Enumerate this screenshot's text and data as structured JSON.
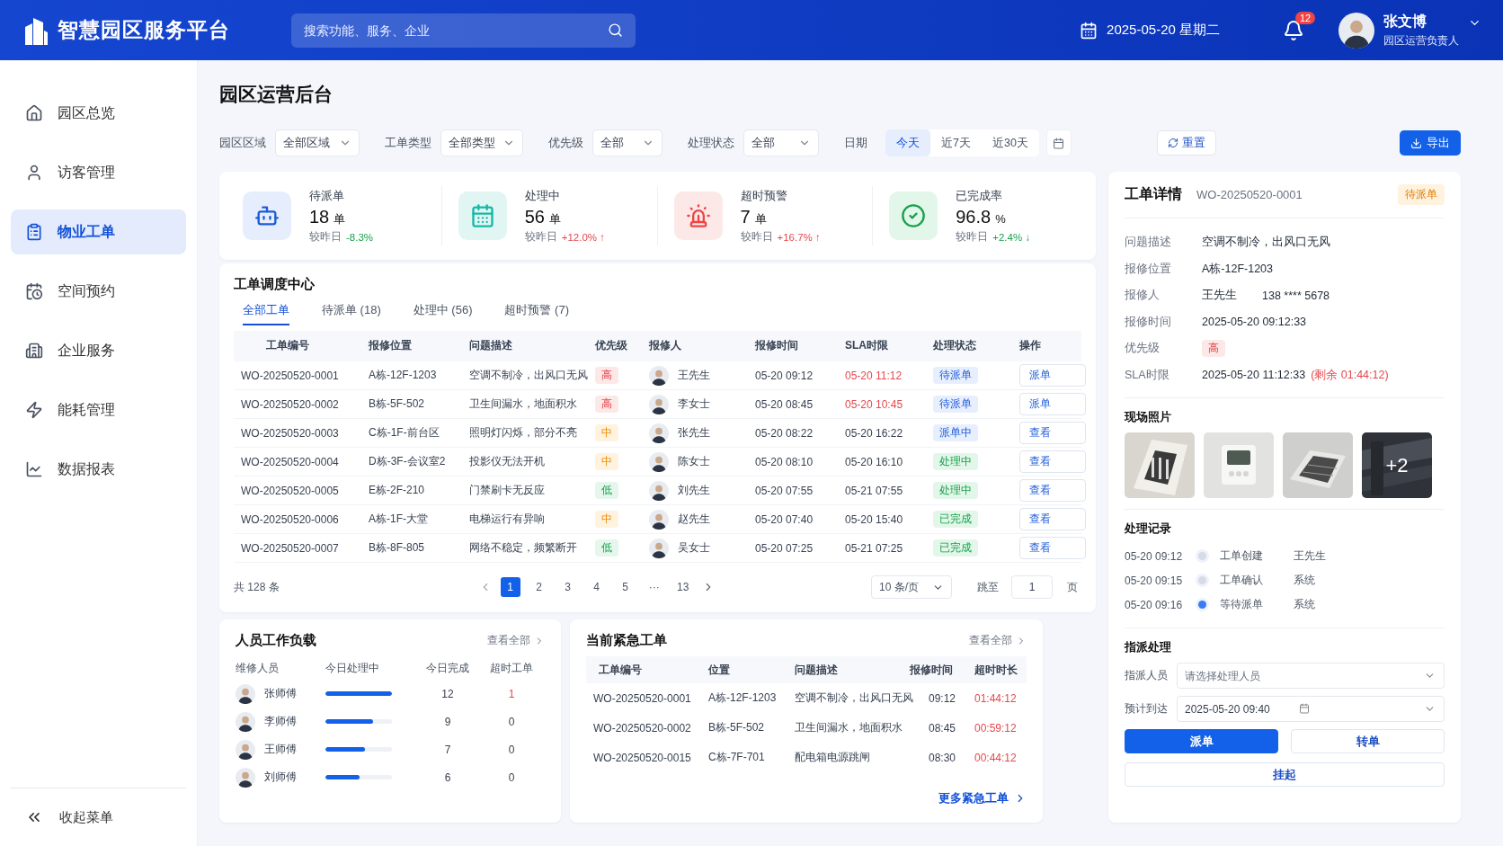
{
  "header": {
    "title": "智慧园区服务平台",
    "search": {
      "placeholder": "搜索功能、服务、企业"
    },
    "date": "2025-05-20 星期二",
    "notifications": "12",
    "user": {
      "name": "张文博",
      "role": "园区运营负责人"
    }
  },
  "sidebar": {
    "items": [
      {
        "label": "园区总览",
        "selected": false
      },
      {
        "label": "访客管理",
        "selected": false
      },
      {
        "label": "物业工单",
        "selected": true
      },
      {
        "label": "空间预约",
        "selected": false
      },
      {
        "label": "企业服务",
        "selected": false
      },
      {
        "label": "能耗管理",
        "selected": false
      },
      {
        "label": "数据报表",
        "selected": false
      }
    ],
    "collapse": "收起菜单"
  },
  "page_title": "园区运营后台",
  "filters": {
    "selects": [
      {
        "label": "园区区域",
        "value": "全部区域"
      },
      {
        "label": "工单类型",
        "value": "全部类型"
      },
      {
        "label": "优先级",
        "value": "全部"
      },
      {
        "label": "处理状态",
        "value": "全部"
      }
    ],
    "date_label": "日期",
    "ranges": [
      {
        "label": "今天",
        "selected": true
      },
      {
        "label": "近7天",
        "selected": false
      },
      {
        "label": "近30天",
        "selected": false
      }
    ],
    "reset": "重置",
    "export": "导出"
  },
  "kpis": [
    {
      "label": "待派单",
      "value": "18",
      "unit": "单",
      "compare": "较昨日",
      "change": "-8.3%",
      "good": true
    },
    {
      "label": "处理中",
      "value": "56",
      "unit": "单",
      "compare": "较昨日",
      "change": "+12.0%",
      "good": false,
      "arrow": "↑"
    },
    {
      "label": "超时预警",
      "value": "7",
      "unit": "单",
      "compare": "较昨日",
      "change": "+16.7%",
      "good": false,
      "arrow": "↑"
    },
    {
      "label": "已完成率",
      "value": "96.8",
      "unit": "%",
      "compare": "较昨日",
      "change": "+2.4%",
      "good": true,
      "arrow": "↓"
    }
  ],
  "dispatch": {
    "title": "工单调度中心",
    "tabs": [
      {
        "label": "全部工单",
        "selected": true
      },
      {
        "label": "待派单 (18)",
        "selected": false
      },
      {
        "label": "处理中 (56)",
        "selected": false
      },
      {
        "label": "超时预警 (7)",
        "selected": false
      }
    ],
    "columns": [
      "工单编号",
      "报修位置",
      "问题描述",
      "优先级",
      "报修人",
      "报修时间",
      "SLA时限",
      "处理状态",
      "操作"
    ],
    "rows": [
      {
        "id": "WO-20250520-0001",
        "location": "A栋-12F-1203",
        "description": "空调不制冷，出风口无风",
        "priority": {
          "label": "高",
          "kind": "high"
        },
        "reporter": "王先生",
        "time": "05-20 09:12",
        "sla": "05-20 11:12",
        "sla_overdue": true,
        "status": {
          "label": "待派单",
          "kind": "pending"
        },
        "action": "派单"
      },
      {
        "id": "WO-20250520-0002",
        "location": "B栋-5F-502",
        "description": "卫生间漏水，地面积水",
        "priority": {
          "label": "高",
          "kind": "high"
        },
        "reporter": "李女士",
        "time": "05-20 08:45",
        "sla": "05-20 10:45",
        "sla_overdue": true,
        "status": {
          "label": "待派单",
          "kind": "pending"
        },
        "action": "派单"
      },
      {
        "id": "WO-20250520-0003",
        "location": "C栋-1F-前台区",
        "description": "照明灯闪烁，部分不亮",
        "priority": {
          "label": "中",
          "kind": "medium"
        },
        "reporter": "张先生",
        "time": "05-20 08:22",
        "sla": "05-20 16:22",
        "sla_overdue": false,
        "status": {
          "label": "派单中",
          "kind": "dispatching"
        },
        "action": "查看"
      },
      {
        "id": "WO-20250520-0004",
        "location": "D栋-3F-会议室2",
        "description": "投影仪无法开机",
        "priority": {
          "label": "中",
          "kind": "medium"
        },
        "reporter": "陈女士",
        "time": "05-20 08:10",
        "sla": "05-20 16:10",
        "sla_overdue": false,
        "status": {
          "label": "处理中",
          "kind": "processing"
        },
        "action": "查看"
      },
      {
        "id": "WO-20250520-0005",
        "location": "E栋-2F-210",
        "description": "门禁刷卡无反应",
        "priority": {
          "label": "低",
          "kind": "low"
        },
        "reporter": "刘先生",
        "time": "05-20 07:55",
        "sla": "05-21 07:55",
        "sla_overdue": false,
        "status": {
          "label": "处理中",
          "kind": "processing"
        },
        "action": "查看"
      },
      {
        "id": "WO-20250520-0006",
        "location": "A栋-1F-大堂",
        "description": "电梯运行有异响",
        "priority": {
          "label": "中",
          "kind": "medium"
        },
        "reporter": "赵先生",
        "time": "05-20 07:40",
        "sla": "05-20 15:40",
        "sla_overdue": false,
        "status": {
          "label": "已完成",
          "kind": "done"
        },
        "action": "查看"
      },
      {
        "id": "WO-20250520-0007",
        "location": "B栋-8F-805",
        "description": "网络不稳定，频繁断开",
        "priority": {
          "label": "低",
          "kind": "low"
        },
        "reporter": "吴女士",
        "time": "05-20 07:25",
        "sla": "05-21 07:25",
        "sla_overdue": false,
        "status": {
          "label": "已完成",
          "kind": "done"
        },
        "action": "查看"
      }
    ],
    "pagination": {
      "total": "共 128 条",
      "pages": [
        {
          "label": "1",
          "selected": true
        },
        {
          "label": "2",
          "selected": false
        },
        {
          "label": "3",
          "selected": false
        },
        {
          "label": "4",
          "selected": false
        },
        {
          "label": "5",
          "selected": false
        },
        {
          "label": "···",
          "selected": false
        },
        {
          "label": "13",
          "selected": false
        }
      ],
      "page_size": "10 条/页",
      "jump_label": "跳至",
      "jump_value": "1",
      "page_suffix": "页"
    }
  },
  "workload": {
    "title": "人员工作负载",
    "view_all": "查看全部",
    "columns": [
      "维修人员",
      "今日处理中",
      "今日完成",
      "超时工单"
    ],
    "rows": [
      {
        "name": "张师傅",
        "level": 1.0,
        "done": "12",
        "overdue": "1",
        "overdue_alert": true
      },
      {
        "name": "李师傅",
        "level": 0.72,
        "done": "9",
        "overdue": "0",
        "overdue_alert": false
      },
      {
        "name": "王师傅",
        "level": 0.6,
        "done": "7",
        "overdue": "0",
        "overdue_alert": false
      },
      {
        "name": "刘师傅",
        "level": 0.52,
        "done": "6",
        "overdue": "0",
        "overdue_alert": false
      }
    ]
  },
  "urgent": {
    "title": "当前紧急工单",
    "view_all": "查看全部",
    "columns": [
      "工单编号",
      "位置",
      "问题描述",
      "报修时间",
      "超时时长"
    ],
    "rows": [
      {
        "id": "WO-20250520-0001",
        "location": "A栋-12F-1203",
        "description": "空调不制冷，出风口无风",
        "time": "09:12",
        "overtime": "01:44:12"
      },
      {
        "id": "WO-20250520-0002",
        "location": "B栋-5F-502",
        "description": "卫生间漏水，地面积水",
        "time": "08:45",
        "overtime": "00:59:12"
      },
      {
        "id": "WO-20250520-0015",
        "location": "C栋-7F-701",
        "description": "配电箱电源跳闸",
        "time": "08:30",
        "overtime": "00:44:12"
      }
    ],
    "more": "更多紧急工单"
  },
  "detail": {
    "title": "工单详情",
    "id": "WO-20250520-0001",
    "status": "待派单",
    "fields": [
      {
        "label": "问题描述",
        "kind": "text",
        "value": "空调不制冷，出风口无风"
      },
      {
        "label": "报修位置",
        "kind": "text",
        "value": "A栋-12F-1203"
      },
      {
        "label": "报修人",
        "kind": "contact",
        "value": "王先生",
        "phone": "138 **** 5678"
      },
      {
        "label": "报修时间",
        "kind": "text",
        "value": "2025-05-20 09:12:33"
      },
      {
        "label": "优先级",
        "kind": "tag",
        "value": "高"
      },
      {
        "label": "SLA时限",
        "kind": "deadline",
        "value": "2025-05-20 11:12:33",
        "remaining": "(剩余 01:44:12)"
      }
    ],
    "photos": {
      "title": "现场照片",
      "more": "+2"
    },
    "records": {
      "title": "处理记录",
      "items": [
        {
          "time": "05-20 09:12",
          "action": "工单创建",
          "actor": "王先生",
          "current": false
        },
        {
          "time": "05-20 09:15",
          "action": "工单确认",
          "actor": "系统",
          "current": false
        },
        {
          "time": "05-20 09:16",
          "action": "等待派单",
          "actor": "系统",
          "current": true
        }
      ]
    },
    "assign": {
      "title": "指派处理",
      "person_label": "指派人员",
      "person_placeholder": "请选择处理人员",
      "eta_label": "预计到达",
      "eta_value": "2025-05-20 09:40",
      "dispatch": "派单",
      "transfer": "转单",
      "suspend": "挂起"
    }
  }
}
